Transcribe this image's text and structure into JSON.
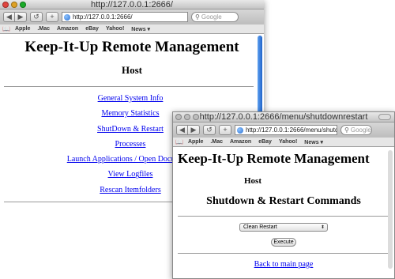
{
  "back_window": {
    "title": "http://127.0.0.1:2666/",
    "address": "http://127.0.0.1:2666/",
    "search_placeholder": "Google",
    "bookmarks": [
      "Apple",
      ".Mac",
      "Amazon",
      "eBay",
      "Yahoo!",
      "News ▾"
    ],
    "page": {
      "heading": "Keep-It-Up Remote Management",
      "subtitle": "Host",
      "links": [
        "General System Info",
        "Memory Statistics",
        "ShutDown & Restart",
        "Processes",
        "Launch Applications / Open Documents",
        "View Logfiles",
        "Rescan Itemfolders"
      ]
    }
  },
  "front_window": {
    "title": "http://127.0.0.1:2666/menu/shutdownrestart",
    "address": "http://127.0.0.1:2666/menu/shutdownrestart",
    "search_placeholder": "Google",
    "bookmarks": [
      "Apple",
      ".Mac",
      "Amazon",
      "eBay",
      "Yahoo!",
      "News ▾"
    ],
    "page": {
      "heading": "Keep-It-Up Remote Management",
      "subtitle": "Host",
      "section_title": "Shutdown & Restart Commands",
      "select_value": "Clean Restart",
      "execute_label": "Execute",
      "back_link": "Back to main page"
    }
  },
  "toolbar": {
    "back_icon": "◀",
    "forward_icon": "▶",
    "reload_icon": "↺",
    "add_icon": "+"
  },
  "colors": {
    "link": "#0000ee",
    "scroll_thumb": "#2f76d6"
  }
}
